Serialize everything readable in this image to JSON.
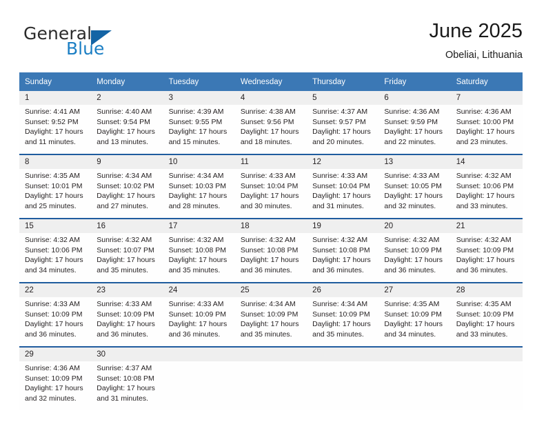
{
  "logo": {
    "word_one": "General",
    "word_two": "Blue",
    "triangle_icon": "triangle-icon"
  },
  "header": {
    "title": "June 2025",
    "subtitle": "Obeliai, Lithuania"
  },
  "colors": {
    "header_blue": "#3b78b5",
    "separator_blue": "#1f5c9e",
    "daynum_band": "#efefef",
    "logo_blue": "#1c7fc4",
    "text": "#231f20"
  },
  "weekday_headers": [
    "Sunday",
    "Monday",
    "Tuesday",
    "Wednesday",
    "Thursday",
    "Friday",
    "Saturday"
  ],
  "labels": {
    "sunrise_prefix": "Sunrise:",
    "sunset_prefix": "Sunset:",
    "daylight_prefix": "Daylight:"
  },
  "weeks": [
    {
      "days": [
        {
          "num": "1",
          "sunrise": "Sunrise: 4:41 AM",
          "sunset": "Sunset: 9:52 PM",
          "daylight_1": "Daylight: 17 hours",
          "daylight_2": "and 11 minutes."
        },
        {
          "num": "2",
          "sunrise": "Sunrise: 4:40 AM",
          "sunset": "Sunset: 9:54 PM",
          "daylight_1": "Daylight: 17 hours",
          "daylight_2": "and 13 minutes."
        },
        {
          "num": "3",
          "sunrise": "Sunrise: 4:39 AM",
          "sunset": "Sunset: 9:55 PM",
          "daylight_1": "Daylight: 17 hours",
          "daylight_2": "and 15 minutes."
        },
        {
          "num": "4",
          "sunrise": "Sunrise: 4:38 AM",
          "sunset": "Sunset: 9:56 PM",
          "daylight_1": "Daylight: 17 hours",
          "daylight_2": "and 18 minutes."
        },
        {
          "num": "5",
          "sunrise": "Sunrise: 4:37 AM",
          "sunset": "Sunset: 9:57 PM",
          "daylight_1": "Daylight: 17 hours",
          "daylight_2": "and 20 minutes."
        },
        {
          "num": "6",
          "sunrise": "Sunrise: 4:36 AM",
          "sunset": "Sunset: 9:59 PM",
          "daylight_1": "Daylight: 17 hours",
          "daylight_2": "and 22 minutes."
        },
        {
          "num": "7",
          "sunrise": "Sunrise: 4:36 AM",
          "sunset": "Sunset: 10:00 PM",
          "daylight_1": "Daylight: 17 hours",
          "daylight_2": "and 23 minutes."
        }
      ]
    },
    {
      "days": [
        {
          "num": "8",
          "sunrise": "Sunrise: 4:35 AM",
          "sunset": "Sunset: 10:01 PM",
          "daylight_1": "Daylight: 17 hours",
          "daylight_2": "and 25 minutes."
        },
        {
          "num": "9",
          "sunrise": "Sunrise: 4:34 AM",
          "sunset": "Sunset: 10:02 PM",
          "daylight_1": "Daylight: 17 hours",
          "daylight_2": "and 27 minutes."
        },
        {
          "num": "10",
          "sunrise": "Sunrise: 4:34 AM",
          "sunset": "Sunset: 10:03 PM",
          "daylight_1": "Daylight: 17 hours",
          "daylight_2": "and 28 minutes."
        },
        {
          "num": "11",
          "sunrise": "Sunrise: 4:33 AM",
          "sunset": "Sunset: 10:04 PM",
          "daylight_1": "Daylight: 17 hours",
          "daylight_2": "and 30 minutes."
        },
        {
          "num": "12",
          "sunrise": "Sunrise: 4:33 AM",
          "sunset": "Sunset: 10:04 PM",
          "daylight_1": "Daylight: 17 hours",
          "daylight_2": "and 31 minutes."
        },
        {
          "num": "13",
          "sunrise": "Sunrise: 4:33 AM",
          "sunset": "Sunset: 10:05 PM",
          "daylight_1": "Daylight: 17 hours",
          "daylight_2": "and 32 minutes."
        },
        {
          "num": "14",
          "sunrise": "Sunrise: 4:32 AM",
          "sunset": "Sunset: 10:06 PM",
          "daylight_1": "Daylight: 17 hours",
          "daylight_2": "and 33 minutes."
        }
      ]
    },
    {
      "days": [
        {
          "num": "15",
          "sunrise": "Sunrise: 4:32 AM",
          "sunset": "Sunset: 10:06 PM",
          "daylight_1": "Daylight: 17 hours",
          "daylight_2": "and 34 minutes."
        },
        {
          "num": "16",
          "sunrise": "Sunrise: 4:32 AM",
          "sunset": "Sunset: 10:07 PM",
          "daylight_1": "Daylight: 17 hours",
          "daylight_2": "and 35 minutes."
        },
        {
          "num": "17",
          "sunrise": "Sunrise: 4:32 AM",
          "sunset": "Sunset: 10:08 PM",
          "daylight_1": "Daylight: 17 hours",
          "daylight_2": "and 35 minutes."
        },
        {
          "num": "18",
          "sunrise": "Sunrise: 4:32 AM",
          "sunset": "Sunset: 10:08 PM",
          "daylight_1": "Daylight: 17 hours",
          "daylight_2": "and 36 minutes."
        },
        {
          "num": "19",
          "sunrise": "Sunrise: 4:32 AM",
          "sunset": "Sunset: 10:08 PM",
          "daylight_1": "Daylight: 17 hours",
          "daylight_2": "and 36 minutes."
        },
        {
          "num": "20",
          "sunrise": "Sunrise: 4:32 AM",
          "sunset": "Sunset: 10:09 PM",
          "daylight_1": "Daylight: 17 hours",
          "daylight_2": "and 36 minutes."
        },
        {
          "num": "21",
          "sunrise": "Sunrise: 4:32 AM",
          "sunset": "Sunset: 10:09 PM",
          "daylight_1": "Daylight: 17 hours",
          "daylight_2": "and 36 minutes."
        }
      ]
    },
    {
      "days": [
        {
          "num": "22",
          "sunrise": "Sunrise: 4:33 AM",
          "sunset": "Sunset: 10:09 PM",
          "daylight_1": "Daylight: 17 hours",
          "daylight_2": "and 36 minutes."
        },
        {
          "num": "23",
          "sunrise": "Sunrise: 4:33 AM",
          "sunset": "Sunset: 10:09 PM",
          "daylight_1": "Daylight: 17 hours",
          "daylight_2": "and 36 minutes."
        },
        {
          "num": "24",
          "sunrise": "Sunrise: 4:33 AM",
          "sunset": "Sunset: 10:09 PM",
          "daylight_1": "Daylight: 17 hours",
          "daylight_2": "and 36 minutes."
        },
        {
          "num": "25",
          "sunrise": "Sunrise: 4:34 AM",
          "sunset": "Sunset: 10:09 PM",
          "daylight_1": "Daylight: 17 hours",
          "daylight_2": "and 35 minutes."
        },
        {
          "num": "26",
          "sunrise": "Sunrise: 4:34 AM",
          "sunset": "Sunset: 10:09 PM",
          "daylight_1": "Daylight: 17 hours",
          "daylight_2": "and 35 minutes."
        },
        {
          "num": "27",
          "sunrise": "Sunrise: 4:35 AM",
          "sunset": "Sunset: 10:09 PM",
          "daylight_1": "Daylight: 17 hours",
          "daylight_2": "and 34 minutes."
        },
        {
          "num": "28",
          "sunrise": "Sunrise: 4:35 AM",
          "sunset": "Sunset: 10:09 PM",
          "daylight_1": "Daylight: 17 hours",
          "daylight_2": "and 33 minutes."
        }
      ]
    },
    {
      "days": [
        {
          "num": "29",
          "sunrise": "Sunrise: 4:36 AM",
          "sunset": "Sunset: 10:09 PM",
          "daylight_1": "Daylight: 17 hours",
          "daylight_2": "and 32 minutes."
        },
        {
          "num": "30",
          "sunrise": "Sunrise: 4:37 AM",
          "sunset": "Sunset: 10:08 PM",
          "daylight_1": "Daylight: 17 hours",
          "daylight_2": "and 31 minutes."
        },
        {
          "num": "",
          "sunrise": "",
          "sunset": "",
          "daylight_1": "",
          "daylight_2": ""
        },
        {
          "num": "",
          "sunrise": "",
          "sunset": "",
          "daylight_1": "",
          "daylight_2": ""
        },
        {
          "num": "",
          "sunrise": "",
          "sunset": "",
          "daylight_1": "",
          "daylight_2": ""
        },
        {
          "num": "",
          "sunrise": "",
          "sunset": "",
          "daylight_1": "",
          "daylight_2": ""
        },
        {
          "num": "",
          "sunrise": "",
          "sunset": "",
          "daylight_1": "",
          "daylight_2": ""
        }
      ]
    }
  ]
}
